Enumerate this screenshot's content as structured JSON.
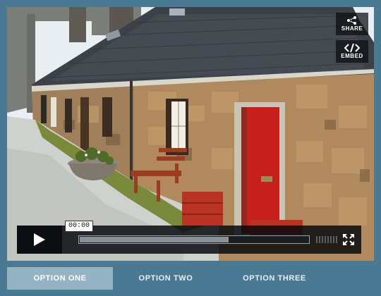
{
  "player": {
    "share_label": "SHARE",
    "embed_label": "EMBED",
    "share_icon": "share-icon",
    "embed_icon": "code-icon",
    "timecode": "00:00",
    "progress_fraction": 0.65,
    "play_icon": "play-icon",
    "volume_icon": "volume-bars-icon",
    "fullscreen_icon": "fullscreen-icon"
  },
  "tabs": [
    {
      "label": "OPTION ONE",
      "active": true
    },
    {
      "label": "OPTION TWO",
      "active": false
    },
    {
      "label": "OPTION THREE",
      "active": false
    }
  ],
  "colors": {
    "page_bg": "#4a7a93",
    "active_tab": "#94b3c3",
    "door_red": "#c81f1f"
  }
}
